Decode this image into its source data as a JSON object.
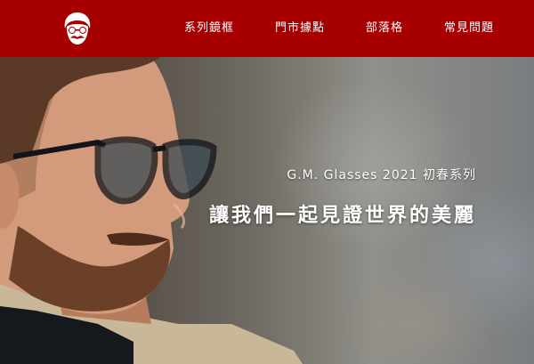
{
  "navbar": {
    "logo_icon": "gentleman-glasses-mustache-logo-icon",
    "items": [
      {
        "label": "系列鏡框"
      },
      {
        "label": "門市據點"
      },
      {
        "label": "部落格"
      },
      {
        "label": "常見問題"
      }
    ]
  },
  "hero": {
    "subtitle": "G.M. Glasses 2021 初春系列",
    "title": "讓我們一起見證世界的美麗"
  },
  "colors": {
    "brand_red": "#a60000",
    "text": "#ffffff"
  }
}
